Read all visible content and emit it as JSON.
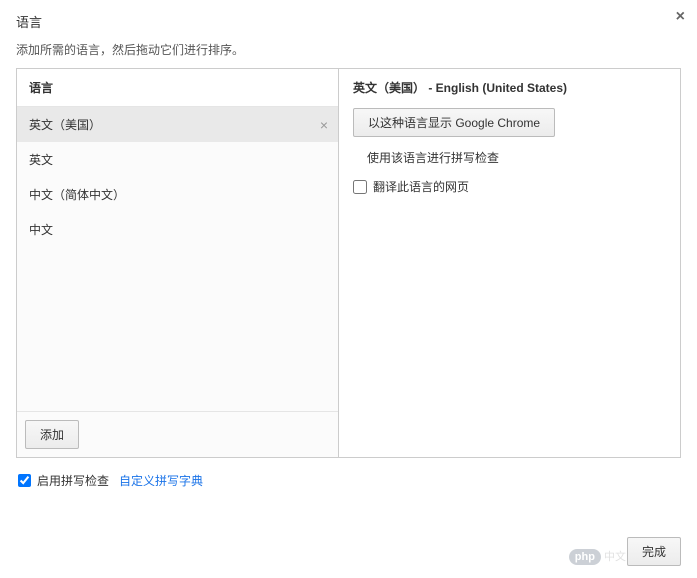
{
  "dialog": {
    "title": "语言",
    "description": "添加所需的语言，然后拖动它们进行排序。",
    "close_label": "×"
  },
  "left": {
    "header": "语言",
    "items": [
      {
        "label": "英文（美国）",
        "selected": true
      },
      {
        "label": "英文",
        "selected": false
      },
      {
        "label": "中文（简体中文）",
        "selected": false
      },
      {
        "label": "中文",
        "selected": false
      }
    ],
    "remove_glyph": "×",
    "add_button": "添加"
  },
  "right": {
    "title": "英文（美国） - English (United States)",
    "display_button": "以这种语言显示 Google Chrome",
    "spellcheck_text": "使用该语言进行拼写检查",
    "translate_checkbox": "翻译此语言的网页",
    "translate_checked": false
  },
  "footer": {
    "enable_spellcheck_label": "启用拼写检查",
    "enable_spellcheck_checked": true,
    "custom_dict_link": "自定义拼写字典",
    "done_button": "完成"
  },
  "watermark": {
    "php": "php",
    "text": "中文网"
  }
}
